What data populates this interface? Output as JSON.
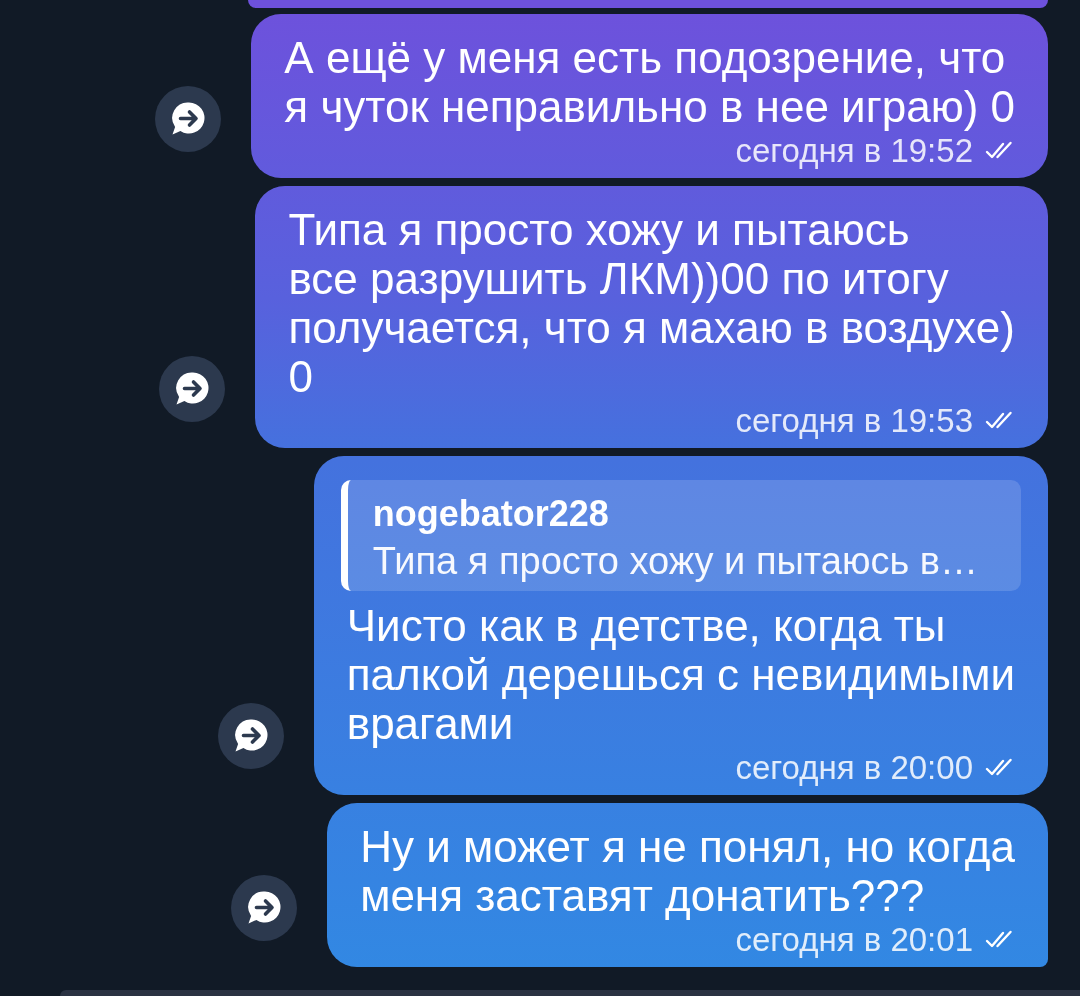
{
  "messages": [
    {
      "text": "А ещё у меня есть подозрение, что\nя чуток неправильно в нее играю) 0",
      "time": "сегодня в 19:52",
      "read": true
    },
    {
      "text": "Типа я просто хожу и пытаюсь\nвсе разрушить ЛКМ))00 по итогу\nполучается, что я махаю в воздухе)\n0",
      "time": "сегодня в 19:53",
      "read": true
    },
    {
      "reply": {
        "author": "nogebator228",
        "text": "Типа я просто хожу и пытаюсь в…"
      },
      "text": "Чисто как в детстве, когда ты\nпалкой дерешься с невидимыми\nврагами",
      "time": "сегодня в 20:00",
      "read": true
    },
    {
      "text": "Ну и может я не понял, но когда\nменя заставят донатить???",
      "time": "сегодня в 20:01",
      "read": true
    }
  ]
}
